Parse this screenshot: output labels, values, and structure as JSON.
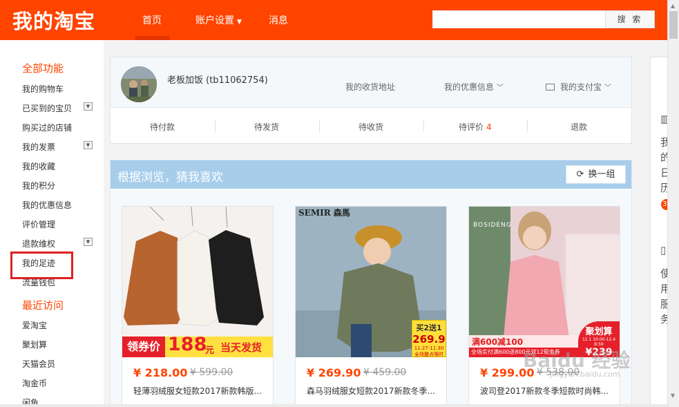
{
  "header": {
    "logo": "我的淘宝",
    "nav": {
      "home": "首页",
      "account": "账户设置",
      "messages": "消息"
    },
    "search": {
      "placeholder": "",
      "button": "搜 索"
    }
  },
  "sidebar": {
    "all_title": "全部功能",
    "items": [
      "我的购物车",
      "已买到的宝贝",
      "购买过的店铺",
      "我的发票",
      "我的收藏",
      "我的积分",
      "我的优惠信息",
      "评价管理",
      "退款维权",
      "我的足迹",
      "流量钱包"
    ],
    "recent_title": "最近访问",
    "recent": [
      "爱淘宝",
      "聚划算",
      "天猫会员",
      "淘金币",
      "闲鱼"
    ]
  },
  "profile": {
    "username": "老板加饭 (tb11062754)",
    "links": {
      "address": "我的收货地址",
      "coupons": "我的优惠信息",
      "alipay": "我的支付宝"
    },
    "orders": [
      {
        "label": "待付款",
        "count": ""
      },
      {
        "label": "待发货",
        "count": ""
      },
      {
        "label": "待收货",
        "count": ""
      },
      {
        "label": "待评价",
        "count": "4"
      },
      {
        "label": "退款",
        "count": ""
      }
    ]
  },
  "recommend": {
    "title": "根据浏览，猜我喜欢",
    "refresh": "换一组",
    "products": [
      {
        "price": "¥ 218.00",
        "old_price": "¥ 599.00",
        "name": "轻薄羽绒服女短款2017新款韩版...",
        "banner_label": "领券价",
        "banner_price": "188",
        "banner_unit": "元",
        "banner_tag": "当天发货"
      },
      {
        "price": "¥ 269.90",
        "old_price": "¥ 459.00",
        "name": "森马羽绒服女短款2017新款冬季...",
        "brand": "SEMIR 森馬",
        "badge_line1": "买2送1",
        "badge_line2": "269.9",
        "badge_line3": "11.27-11.30 全场整点限时"
      },
      {
        "price": "¥ 299.00",
        "old_price": "¥ 538.00",
        "name": "波司登2017新款冬季短款时尚韩...",
        "brand": "BOSIDENG",
        "promo1": "满600减100",
        "promo2": "全场实付满600送800元双12现金券",
        "jhs_title": "聚划算",
        "jhs_date": "12.1 10:00-12.4 8:59",
        "jhs_price": "¥239"
      }
    ]
  },
  "right_panel": {
    "chars": [
      "我",
      "的",
      "日",
      "历",
      "使",
      "用",
      "服",
      "务"
    ],
    "badge": "3"
  },
  "watermark": {
    "main": "Baidu 经验",
    "sub": "jingyan.baidu.com"
  }
}
